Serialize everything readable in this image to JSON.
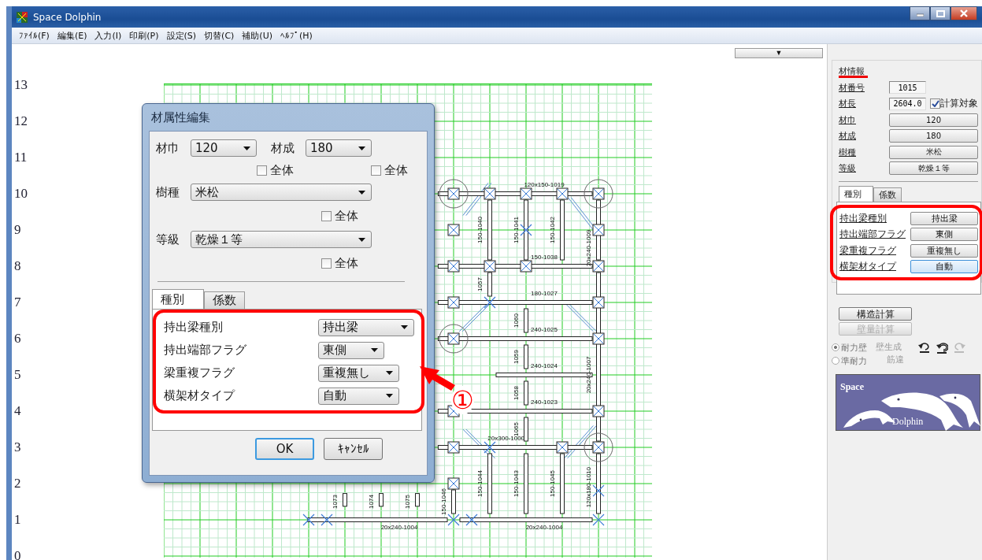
{
  "window": {
    "title": "Space Dolphin"
  },
  "menu": [
    "ﾌｧｲﾙ(F)",
    "編集(E)",
    "入力(I)",
    "印刷(P)",
    "設定(S)",
    "切替(C)",
    "補助(U)",
    "ﾍﾙﾌﾟ(H)"
  ],
  "view_toggle": "▼",
  "axis_labels": [
    "13",
    "12",
    "11",
    "10",
    "9",
    "8",
    "7",
    "6",
    "5",
    "4",
    "3",
    "2",
    "1",
    "0"
  ],
  "plan": {
    "beam_labels": [
      "120x150-1019",
      "150-1038",
      "180-1027",
      "240-1025",
      "240-1024",
      "240-1023",
      "20x300-1000",
      "20x240-1004",
      "20x240-1004",
      "150-1040",
      "1057",
      "150-1044",
      "150-1041",
      "1060",
      "1059",
      "1058",
      "1065",
      "150-1043",
      "150-1042",
      "150-1045",
      "150-1046",
      "20x240-1009",
      "20x240-1007",
      "120x180-1010",
      "1073",
      "1074",
      "1075"
    ]
  },
  "dialog": {
    "title": "材属性編集",
    "fields": [
      {
        "kind": "short",
        "label": "材巾",
        "value": "120",
        "all_label": "全体",
        "all_checked": false
      },
      {
        "kind": "short",
        "label": "材成",
        "value": "180",
        "all_label": "全体",
        "all_checked": false
      },
      {
        "kind": "wide",
        "label": "樹種",
        "value": "米松",
        "all_label": "全体",
        "all_checked": false
      },
      {
        "kind": "wide",
        "label": "等級",
        "value": "乾燥１等",
        "all_label": "全体",
        "all_checked": false
      }
    ],
    "tabs": [
      {
        "label": "種別",
        "selected": true
      },
      {
        "label": "係数",
        "selected": false
      }
    ],
    "options": [
      {
        "label": "持出梁種別",
        "value": "持出梁"
      },
      {
        "label": "持出端部フラグ",
        "value": "東側"
      },
      {
        "label": "梁重複フラグ",
        "value": "重複無し"
      },
      {
        "label": "横架材タイプ",
        "value": "自動"
      }
    ],
    "buttons": [
      {
        "label": "OK",
        "default": true
      },
      {
        "label": "ｷｬﾝｾﾙ",
        "default": false
      }
    ]
  },
  "side_panel": {
    "group_title": "材情報",
    "rows": [
      {
        "kind": "field",
        "label": "材番号",
        "value": "1015"
      },
      {
        "kind": "field",
        "label": "材長",
        "value": "2604.0",
        "checkbox": {
          "label": "計算対象",
          "checked": true
        }
      },
      {
        "kind": "button",
        "label": "材巾",
        "value": "120"
      },
      {
        "kind": "button",
        "label": "材成",
        "value": "180"
      },
      {
        "kind": "button",
        "label": "樹種",
        "value": "米松"
      },
      {
        "kind": "button",
        "label": "等級",
        "value": "乾燥１等"
      }
    ],
    "tabs": [
      {
        "label": "種別",
        "selected": true
      },
      {
        "label": "係数",
        "selected": false
      }
    ],
    "options": [
      {
        "label": "持出梁種別",
        "value": "持出梁",
        "focused": false
      },
      {
        "label": "持出端部フラグ",
        "value": "東側",
        "focused": false
      },
      {
        "label": "梁重複フラグ",
        "value": "重複無し",
        "focused": false
      },
      {
        "label": "横架材タイプ",
        "value": "自動",
        "focused": true
      }
    ],
    "buttons": [
      {
        "label": "構造計算",
        "disabled": false
      },
      {
        "label": "壁量計算",
        "disabled": true
      }
    ],
    "radios": [
      {
        "label": "耐力壁",
        "selected": true
      },
      {
        "label": "準耐力",
        "selected": false
      }
    ],
    "actions": [
      {
        "label": "壁生成",
        "disabled": true
      },
      {
        "label": "筋違",
        "disabled": true
      }
    ],
    "history": [
      {
        "kind": "undo",
        "disabled": false
      },
      {
        "kind": "undo_all",
        "disabled": false
      },
      {
        "kind": "redo",
        "disabled": true
      }
    ],
    "logo": {
      "top": "Space",
      "bottom": "Dolphin"
    }
  },
  "annotation": {
    "number": "①"
  }
}
